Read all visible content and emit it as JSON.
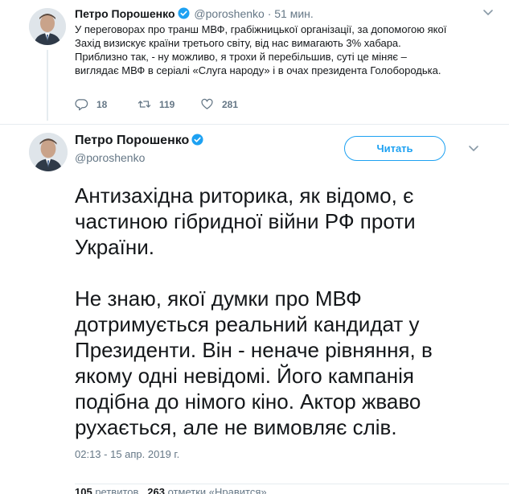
{
  "tweet1": {
    "author_name": "Петро Порошенко",
    "handle": "@poroshenko",
    "time": "· 51 мин.",
    "paragraphs": [
      "У переговорах про транш МВФ, грабіжницької організації, за допомогою якої\nЗахід визискує країни третього світу, від нас вимагають 3% хабара.",
      "Приблизно так, - ну можливо, я трохи й перебільшив, суті це міняє –\nвиглядає МВФ в серіалі «Слуга народу» і в очах президента Голобородька."
    ],
    "replies": "18",
    "retweets": "119",
    "likes": "281"
  },
  "tweet2": {
    "author_name": "Петро Порошенко",
    "handle": "@poroshenko",
    "follow_label": "Читать",
    "paragraphs": [
      "Антизахідна риторика, як відомо, є\nчастиною гібридної війни РФ проти\nУкраїни.",
      "Не знаю, якої думки про МВФ\nдотримується реальний кандидат у\nПрезиденти. Він - неначе рівняння, в\nякому одні невідомі. Його кампанія\nподібна до німого кіно. Актор жваво\nрухається, але не вимовляє слів."
    ],
    "timestamp": "02:13 - 15 апр. 2019 г.",
    "retweet_count": "105",
    "retweet_label": "ретвитов",
    "like_count": "263",
    "like_label": "отметки «Нравится»"
  },
  "colors": {
    "accent": "#1da1f2",
    "muted": "#657786",
    "text": "#14171a"
  }
}
